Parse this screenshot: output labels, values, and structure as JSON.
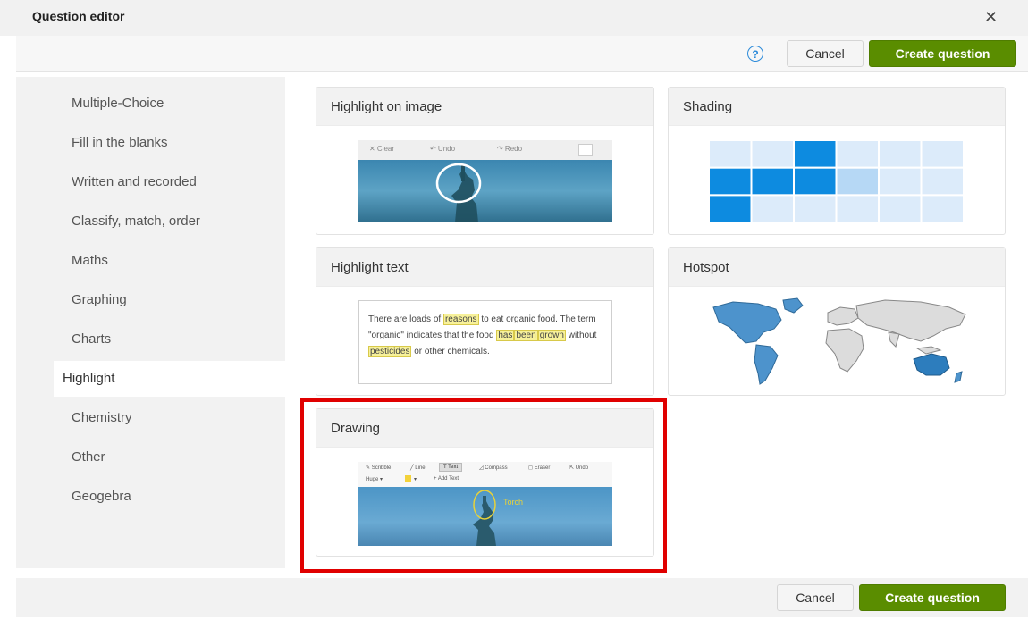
{
  "header": {
    "title": "Question editor",
    "close_glyph": "✕"
  },
  "toolbar": {
    "help_glyph": "?",
    "cancel_label": "Cancel",
    "create_label": "Create question"
  },
  "sidebar": {
    "items": [
      {
        "label": "Multiple-Choice"
      },
      {
        "label": "Fill in the blanks"
      },
      {
        "label": "Written and recorded"
      },
      {
        "label": "Classify, match, order"
      },
      {
        "label": "Maths"
      },
      {
        "label": "Graphing"
      },
      {
        "label": "Charts"
      },
      {
        "label": "Highlight"
      },
      {
        "label": "Chemistry"
      },
      {
        "label": "Other"
      },
      {
        "label": "Geogebra"
      }
    ],
    "active": "Highlight"
  },
  "cards": {
    "highlight_on_image": {
      "title": "Highlight on image",
      "toolbar": [
        "✕ Clear",
        "↶ Undo",
        "↷ Redo"
      ]
    },
    "shading": {
      "title": "Shading"
    },
    "highlight_text": {
      "title": "Highlight text",
      "text": [
        "There are loads of",
        "reasons",
        "to eat organic food. The term \"organic\" indicates that the food",
        "has",
        "been",
        "grown",
        "without",
        "pesticides",
        "or other chemicals."
      ]
    },
    "hotspot": {
      "title": "Hotspot"
    },
    "drawing": {
      "title": "Drawing",
      "toolbar": [
        "✎ Scribble",
        "╱ Line",
        "T Text",
        "◿ Compass",
        "◻ Eraser",
        "⇱ Undo"
      ],
      "toolbar2": [
        "Huge ▾",
        "▾",
        "+ Add Text"
      ],
      "label": "Torch"
    }
  },
  "footer": {
    "cancel_label": "Cancel",
    "create_label": "Create question"
  },
  "colors": {
    "accent_green": "#5a8d00",
    "highlight_red": "#e00000",
    "shading_dark": "#0d8be0",
    "shading_light": "#dcebfa"
  }
}
